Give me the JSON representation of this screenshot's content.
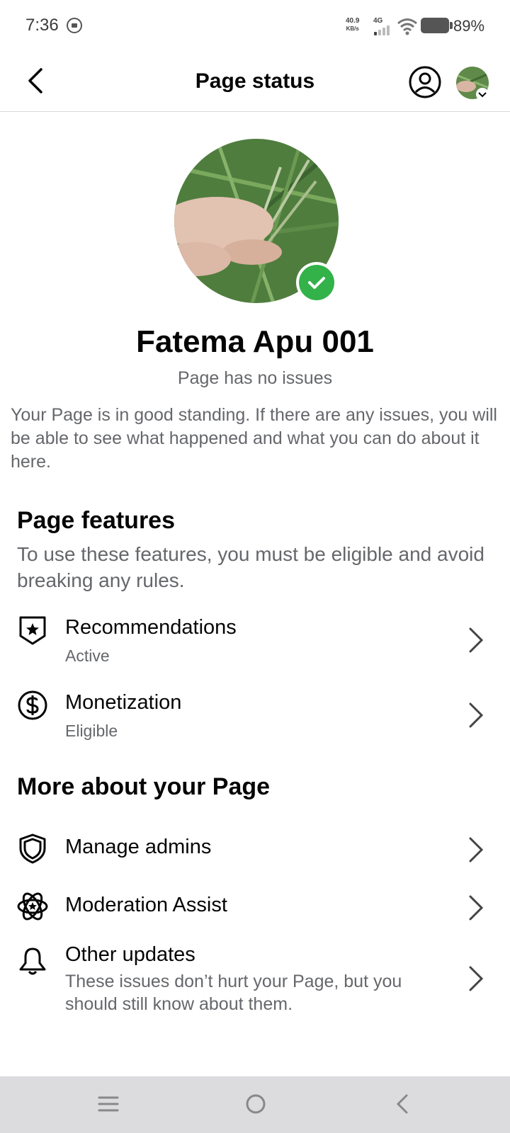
{
  "status_bar": {
    "time": "7:36",
    "speed_value": "40.9",
    "speed_unit": "KB/s",
    "network": "4G",
    "battery": "89%"
  },
  "header": {
    "title": "Page status",
    "back_icon": "back-arrow-icon",
    "profile_icon": "user-circle-icon"
  },
  "page": {
    "name": "Fatema Apu 001",
    "status": "Page has no issues",
    "description": "Your Page is in good standing. If there are any issues, you will be able to see what happened and what you can do about it here.",
    "badge_color": "#33b249"
  },
  "features": {
    "title": "Page features",
    "subtitle": "To use these features, you must be eligible and avoid breaking any rules.",
    "items": [
      {
        "icon": "shield-star-icon",
        "label": "Recommendations",
        "status": "Active"
      },
      {
        "icon": "dollar-circle-icon",
        "label": "Monetization",
        "status": "Eligible"
      }
    ]
  },
  "more": {
    "title": "More about your Page",
    "items": [
      {
        "icon": "shield-icon",
        "label": "Manage admins"
      },
      {
        "icon": "atom-star-icon",
        "label": "Moderation Assist"
      },
      {
        "icon": "bell-icon",
        "label": "Other updates",
        "description": "These issues don’t hurt your Page, but you should still know about them."
      }
    ]
  },
  "nav": {
    "menu_icon": "menu-icon",
    "home_icon": "home-icon",
    "back_icon": "back-icon"
  }
}
